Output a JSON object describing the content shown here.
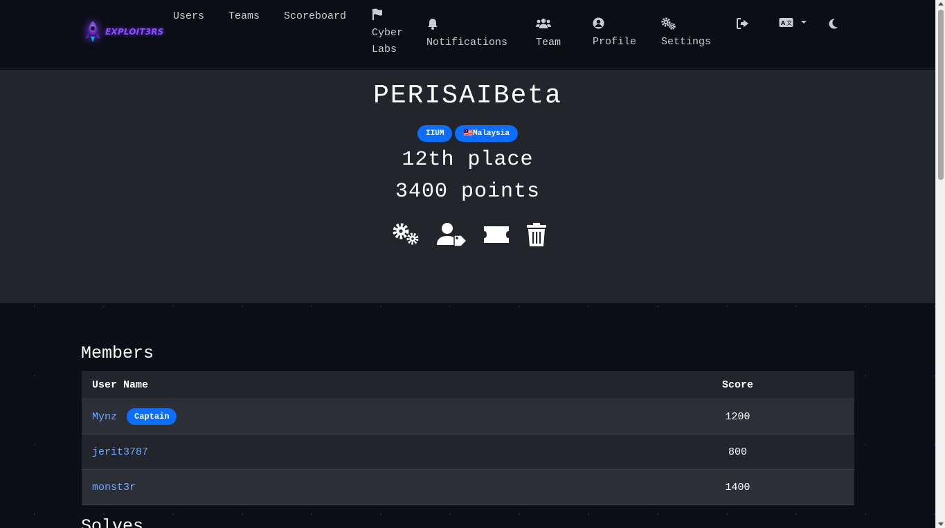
{
  "nav": {
    "brand": "EXPLOIT3RS",
    "links": [
      "Users",
      "Teams",
      "Scoreboard"
    ],
    "cyber_labs": "Cyber Labs",
    "notifications": "Notifications",
    "team": "Team",
    "profile": "Profile",
    "settings": "Settings",
    "icons": {
      "cyber_labs": "flag-icon",
      "notifications": "bell-icon",
      "team": "users-icon",
      "profile": "user-circle-icon",
      "settings": "cogs-icon",
      "logout": "sign-out-icon",
      "language": "language-icon",
      "theme": "moon-icon"
    }
  },
  "team": {
    "name": "PERISAIBeta",
    "badges": [
      "IIUM",
      "🇲🇾Malaysia"
    ],
    "place": "12th place",
    "points": "3400 points",
    "admin_icons": [
      "cogs-icon",
      "user-tag-icon",
      "ticket-icon",
      "trash-icon"
    ]
  },
  "members": {
    "title": "Members",
    "headers": {
      "name": "User Name",
      "score": "Score"
    },
    "rows": [
      {
        "name": "Mynz",
        "badge": "Captain",
        "score": "1200"
      },
      {
        "name": "jerit3787",
        "badge": "",
        "score": "800"
      },
      {
        "name": "monst3r",
        "badge": "",
        "score": "1400"
      }
    ]
  },
  "solves": {
    "title": "Solves"
  },
  "colors": {
    "accent": "#0d6efd",
    "link": "#6ea8fe",
    "navbar": "#0b0e15",
    "jumbotron": "#22252c",
    "page_bg": "#0c0f17"
  }
}
